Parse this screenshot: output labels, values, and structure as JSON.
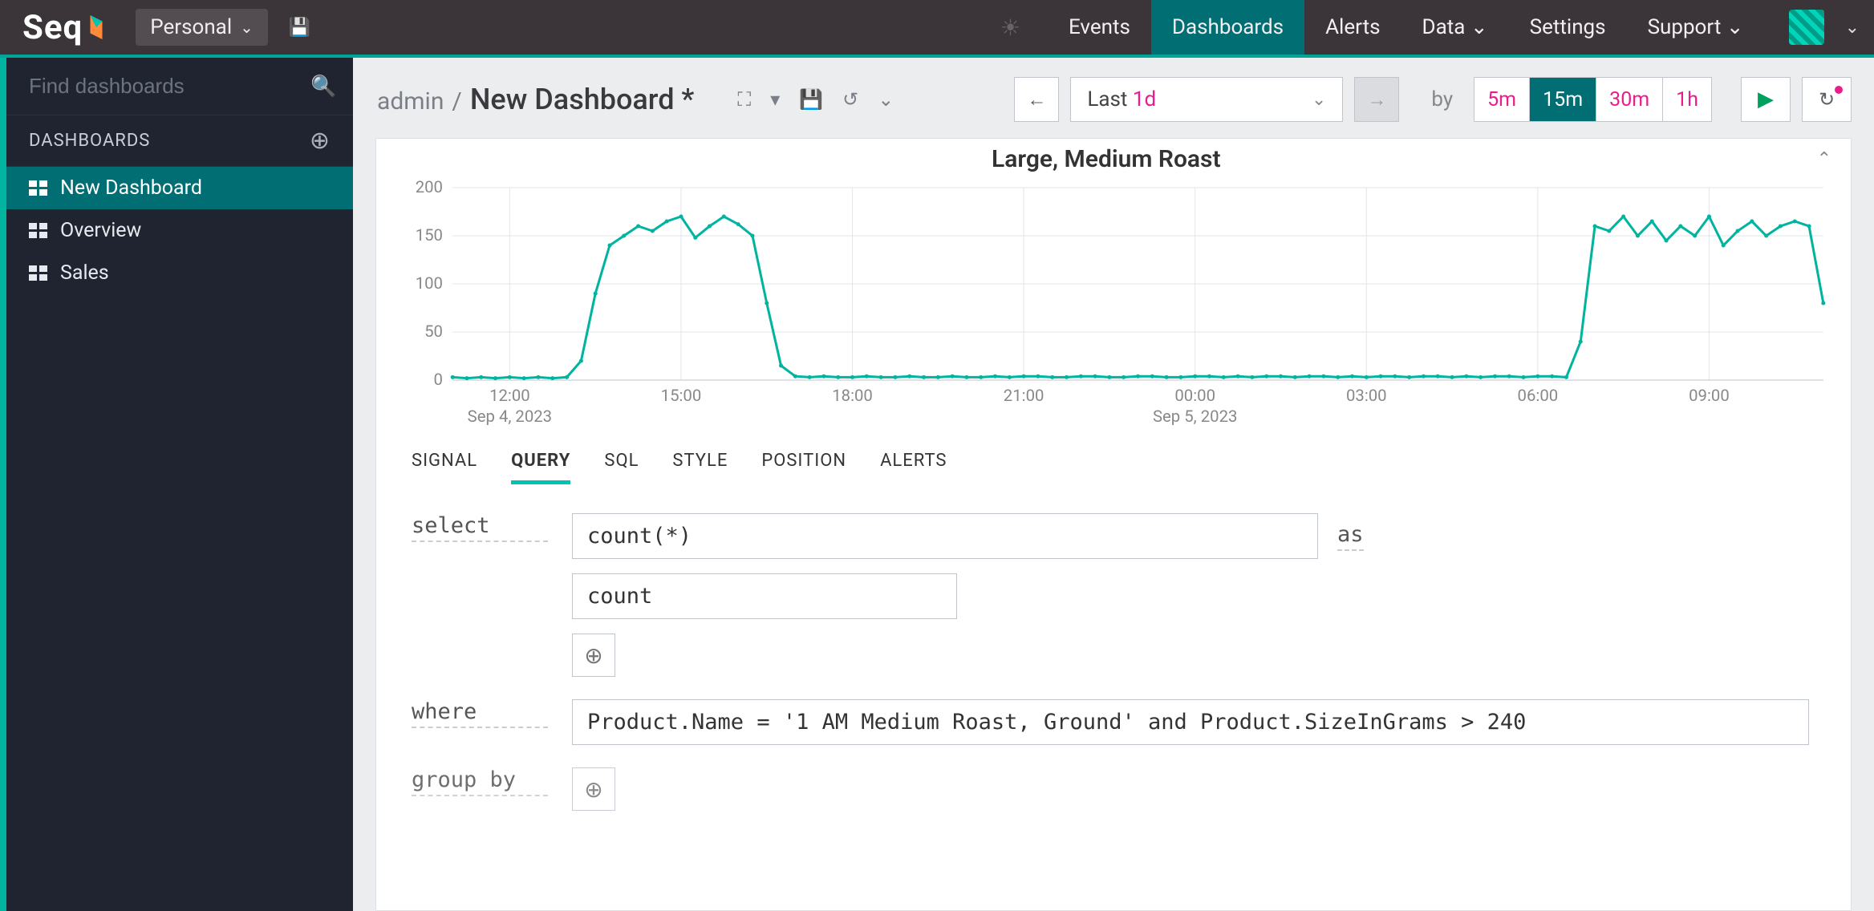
{
  "nav": {
    "logo_text": "Seq",
    "workspace": "Personal",
    "links": [
      {
        "label": "Events"
      },
      {
        "label": "Dashboards",
        "active": true
      },
      {
        "label": "Alerts"
      },
      {
        "label": "Data ⌄"
      },
      {
        "label": "Settings"
      },
      {
        "label": "Support ⌄"
      }
    ]
  },
  "sidebar": {
    "search_placeholder": "Find dashboards",
    "section_label": "DASHBOARDS",
    "items": [
      {
        "label": "New Dashboard",
        "active": true
      },
      {
        "label": "Overview"
      },
      {
        "label": "Sales"
      }
    ]
  },
  "toolbar": {
    "owner": "admin",
    "sep": "/",
    "title": "New Dashboard *",
    "range_prefix": "Last ",
    "range_value": "1d",
    "by_label": "by",
    "buckets": [
      {
        "label": "5m"
      },
      {
        "label": "15m",
        "active": true
      },
      {
        "label": "30m"
      },
      {
        "label": "1h"
      }
    ]
  },
  "chart_data": {
    "type": "line",
    "title": "Large, Medium Roast",
    "ylabel": "",
    "xlabel": "",
    "ylim": [
      0,
      200
    ],
    "yticks": [
      0,
      50,
      100,
      150,
      200
    ],
    "xticks": [
      "12:00",
      "15:00",
      "18:00",
      "21:00",
      "00:00",
      "03:00",
      "06:00",
      "09:00"
    ],
    "xdate_labels": [
      {
        "at": "12:00",
        "text": "Sep 4, 2023"
      },
      {
        "at": "00:00",
        "text": "Sep 5, 2023"
      }
    ],
    "x": [
      "11:00",
      "11:15",
      "11:30",
      "11:45",
      "12:00",
      "12:15",
      "12:30",
      "12:45",
      "13:00",
      "13:15",
      "13:30",
      "13:45",
      "14:00",
      "14:15",
      "14:30",
      "14:45",
      "15:00",
      "15:15",
      "15:30",
      "15:45",
      "16:00",
      "16:15",
      "16:30",
      "16:45",
      "17:00",
      "17:15",
      "17:30",
      "17:45",
      "18:00",
      "18:15",
      "18:30",
      "18:45",
      "19:00",
      "19:15",
      "19:30",
      "19:45",
      "20:00",
      "20:15",
      "20:30",
      "20:45",
      "21:00",
      "21:15",
      "21:30",
      "21:45",
      "22:00",
      "22:15",
      "22:30",
      "22:45",
      "23:00",
      "23:15",
      "23:30",
      "23:45",
      "00:00",
      "00:15",
      "00:30",
      "00:45",
      "01:00",
      "01:15",
      "01:30",
      "01:45",
      "02:00",
      "02:15",
      "02:30",
      "02:45",
      "03:00",
      "03:15",
      "03:30",
      "03:45",
      "04:00",
      "04:15",
      "04:30",
      "04:45",
      "05:00",
      "05:15",
      "05:30",
      "05:45",
      "06:00",
      "06:15",
      "06:30",
      "06:45",
      "07:00",
      "07:15",
      "07:30",
      "07:45",
      "08:00",
      "08:15",
      "08:30",
      "08:45",
      "09:00",
      "09:15",
      "09:30",
      "09:45",
      "10:00",
      "10:15",
      "10:30",
      "10:45",
      "11:00"
    ],
    "series": [
      {
        "name": "count",
        "color": "#00b4a0",
        "values": [
          3,
          2,
          3,
          2,
          3,
          2,
          3,
          2,
          3,
          20,
          90,
          140,
          150,
          160,
          155,
          165,
          170,
          148,
          160,
          170,
          162,
          150,
          80,
          15,
          4,
          3,
          4,
          3,
          3,
          4,
          3,
          3,
          4,
          3,
          3,
          4,
          3,
          3,
          4,
          3,
          4,
          4,
          3,
          3,
          4,
          4,
          3,
          3,
          4,
          4,
          3,
          3,
          4,
          4,
          3,
          4,
          3,
          4,
          4,
          3,
          4,
          4,
          3,
          4,
          3,
          4,
          4,
          3,
          4,
          4,
          3,
          4,
          3,
          4,
          4,
          3,
          4,
          4,
          3,
          40,
          160,
          155,
          170,
          150,
          165,
          145,
          160,
          150,
          170,
          140,
          155,
          165,
          150,
          160,
          165,
          160,
          80
        ]
      }
    ]
  },
  "panel": {
    "tabs": [
      "SIGNAL",
      "QUERY",
      "SQL",
      "STYLE",
      "POSITION",
      "ALERTS"
    ],
    "active_tab": 1
  },
  "query": {
    "select_label": "select",
    "as_label": "as",
    "where_label": "where",
    "groupby_label": "group by",
    "select_expr": "count(*)",
    "select_alias": "count",
    "where_expr": "Product.Name = '1 AM Medium Roast, Ground' and Product.SizeInGrams > 240"
  }
}
